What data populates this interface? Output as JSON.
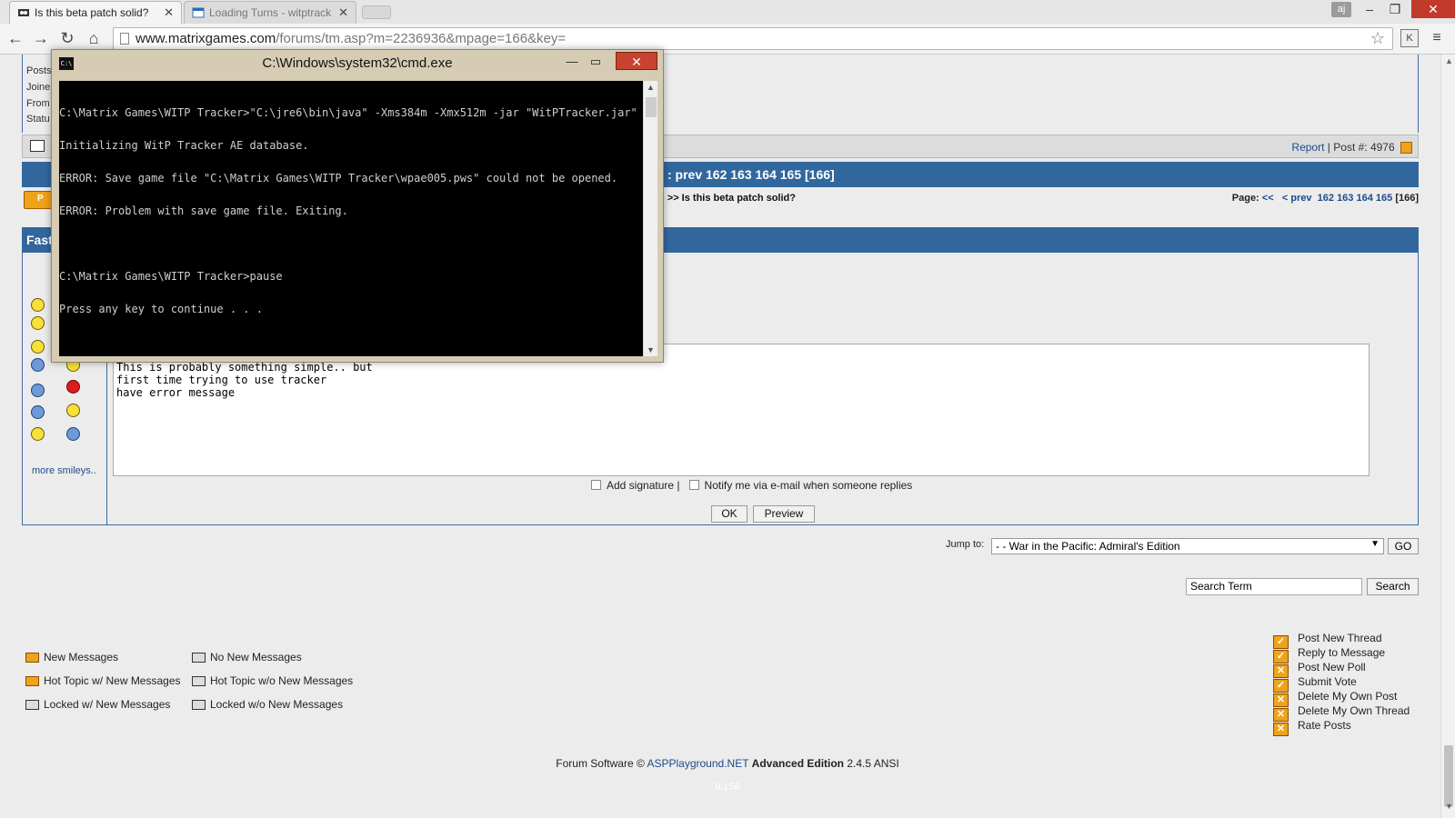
{
  "browser": {
    "tabs": [
      {
        "title": "Is this beta patch solid?",
        "active": true
      },
      {
        "title": "Loading Turns - witptrack",
        "active": false
      }
    ],
    "user_initials": "aj",
    "url_host": "www.matrixgames.com",
    "url_path": "/forums/tm.asp?m=2236936&mpage=166&key=",
    "extension_label": "K"
  },
  "profile": {
    "labels": [
      "Posts",
      "Joine",
      "From",
      "Statu"
    ]
  },
  "post_bar": {
    "report": "Report",
    "separator": "|",
    "post_number": "Post #: 4976"
  },
  "thread_bar": {
    "text": ": prev  162 163 164 165 [166]"
  },
  "breadcrumb": {
    "text": "n >> Is this beta patch solid?",
    "page_label": "Page: ",
    "first": "<<",
    "prev": "< prev",
    "pages": "162 163 164 165",
    "current": "[166]"
  },
  "post_reply_btn": "P",
  "fast_reply": {
    "title": "Fast",
    "more_smileys": "more smileys..",
    "message": "Hi\nThis is probably something simple.. but\nfirst time trying to use tracker\nhave error message",
    "add_signature": "Add signature |",
    "notify": "Notify me via e-mail when someone replies",
    "ok": "OK",
    "preview": "Preview"
  },
  "jump": {
    "label": "Jump to:",
    "selected": "- - War in the Pacific: Admiral's Edition",
    "go": "GO"
  },
  "search": {
    "placeholder": "Search Term",
    "button": "Search"
  },
  "legend": {
    "new_messages": "New Messages",
    "no_new_messages": "No New Messages",
    "hot_new": "Hot Topic w/ New Messages",
    "hot_no_new": "Hot Topic w/o New Messages",
    "locked_new": "Locked w/ New Messages",
    "locked_no_new": "Locked w/o New Messages"
  },
  "permissions": [
    {
      "label": "Post New Thread",
      "allowed": true
    },
    {
      "label": "Reply to Message",
      "allowed": true
    },
    {
      "label": "Post New Poll",
      "allowed": false
    },
    {
      "label": "Submit Vote",
      "allowed": true
    },
    {
      "label": "Delete My Own Post",
      "allowed": false
    },
    {
      "label": "Delete My Own Thread",
      "allowed": false
    },
    {
      "label": "Rate Posts",
      "allowed": false
    }
  ],
  "footer": {
    "prefix": "Forum Software ©",
    "link": "ASPPlayground.NET",
    "edition": "Advanced Edition",
    "version": "2.4.5 ANSI",
    "timing": "0.156"
  },
  "cmd": {
    "title": "C:\\Windows\\system32\\cmd.exe",
    "icon_text": "C:\\",
    "lines": [
      "C:\\Matrix Games\\WITP Tracker>\"C:\\jre6\\bin\\java\" -Xms384m -Xmx512m -jar \"WitPTracker.jar\"",
      "Initializing WitP Tracker AE database.",
      "ERROR: Save game file \"C:\\Matrix Games\\WITP Tracker\\wpae005.pws\" could not be opened.",
      "ERROR: Problem with save game file. Exiting.",
      "",
      "C:\\Matrix Games\\WITP Tracker>pause",
      "Press any key to continue . . ."
    ]
  },
  "colors": {
    "forum_blue": "#32679e",
    "accent_orange": "#f0a31a",
    "close_red": "#c0392b"
  }
}
